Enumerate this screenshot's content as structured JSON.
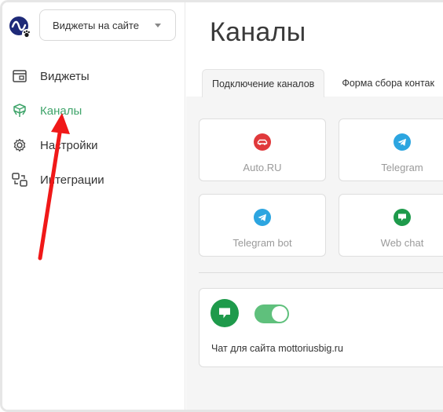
{
  "sidebar": {
    "site_select": {
      "value": "Виджеты на сайте"
    },
    "items": [
      {
        "label": "Виджеты",
        "icon": "widgets-icon"
      },
      {
        "label": "Каналы",
        "icon": "channels-icon",
        "active": true
      },
      {
        "label": "Настройки",
        "icon": "gear-icon"
      },
      {
        "label": "Интеграции",
        "icon": "integrations-icon"
      }
    ]
  },
  "main": {
    "title": "Каналы",
    "tabs": [
      {
        "label": "Подключение каналов",
        "active": true
      },
      {
        "label": "Форма сбора контак"
      }
    ],
    "channels": [
      {
        "label": "Auto.RU",
        "icon": "car-icon",
        "color": "#e0393b"
      },
      {
        "label": "Telegram",
        "icon": "telegram-icon",
        "color": "#2ca5e0"
      },
      {
        "label": "Telegram bot",
        "icon": "telegram-icon",
        "color": "#2ca5e0"
      },
      {
        "label": "Web chat",
        "icon": "chat-bubble-icon",
        "color": "#1e9a4b"
      }
    ],
    "chat_widget": {
      "site": "Чат для сайта mottoriusbig.ru",
      "enabled": true,
      "icon": "chat-bubble-icon",
      "color": "#1e9a4b"
    }
  },
  "colors": {
    "accent": "#3fa46a",
    "annotation_arrow": "#f01818"
  }
}
